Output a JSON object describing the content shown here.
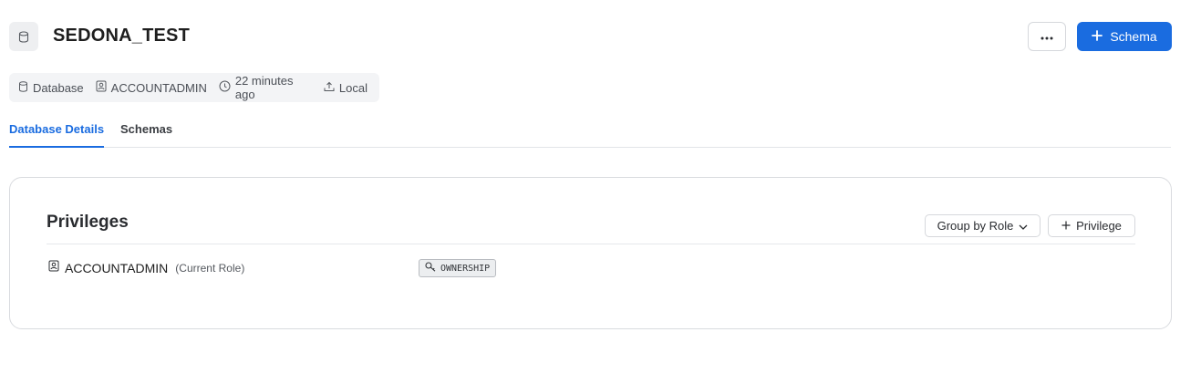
{
  "header": {
    "title": "SEDONA_TEST",
    "icon": "database-icon",
    "more_label": "···",
    "schema_button_label": "Schema"
  },
  "meta": {
    "type": "Database",
    "owner": "ACCOUNTADMIN",
    "updated": "22 minutes ago",
    "source": "Local"
  },
  "tabs": [
    {
      "label": "Database Details",
      "active": true
    },
    {
      "label": "Schemas",
      "active": false
    }
  ],
  "privileges": {
    "title": "Privileges",
    "group_by_label": "Group by Role",
    "add_privilege_label": "Privilege",
    "rows": [
      {
        "role": "ACCOUNTADMIN",
        "note": "(Current Role)",
        "privilege": "OWNERSHIP"
      }
    ]
  },
  "colors": {
    "accent": "#1a6ce0",
    "meta_bg": "#f3f4f6"
  }
}
